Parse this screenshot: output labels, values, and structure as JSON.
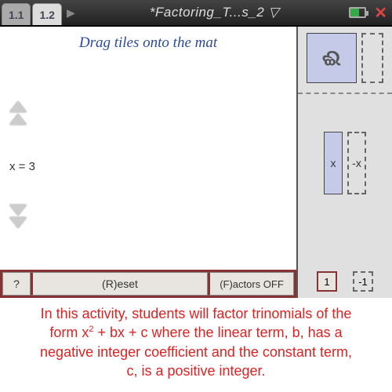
{
  "titlebar": {
    "tab1": "1.1",
    "tab2": "1.2",
    "title": "*Factoring_T...s_2 ▽"
  },
  "canvas": {
    "instruction": "Drag tiles onto the mat",
    "xvalue": "x = 3"
  },
  "buttons": {
    "help": "?",
    "reset": "(R)eset",
    "factors": "(F)actors OFF"
  },
  "palette": {
    "x_label": "x",
    "negx_label": "-x",
    "one": "1",
    "negone": "-1"
  },
  "description": {
    "line1": "In this activity, students will factor trinomials of the",
    "line2a": "form x",
    "line2b": " + bx + c where the linear term, b, has a",
    "line3": "negative integer coefficient and the constant term,",
    "line4": "c, is a positive integer."
  }
}
